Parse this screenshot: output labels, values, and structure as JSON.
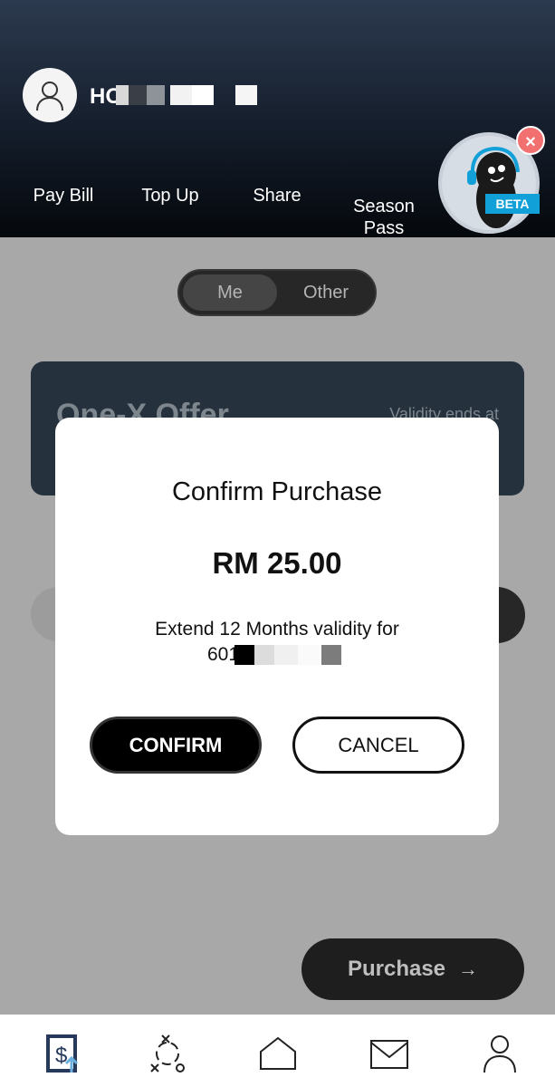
{
  "user": {
    "name_visible": "HO"
  },
  "nav": {
    "items": [
      {
        "label": "Pay Bill"
      },
      {
        "label": "Top Up"
      },
      {
        "label": "Share"
      },
      {
        "label": "Season\nPass"
      }
    ]
  },
  "assistant": {
    "badge": "BETA",
    "close_symbol": "×"
  },
  "toggle": {
    "options": [
      "Me",
      "Other"
    ],
    "selected": "Me"
  },
  "offer": {
    "title": "One-X Offer",
    "validity_label": "Validity ends at"
  },
  "purchase_button": {
    "label": "Purchase",
    "arrow": "→"
  },
  "modal": {
    "title": "Confirm Purchase",
    "amount": "RM 25.00",
    "description": "Extend 12 Months validity for",
    "number_prefix": "601",
    "confirm_label": "CONFIRM",
    "cancel_label": "CANCEL"
  },
  "tabbar": {
    "icons": [
      "billing-icon",
      "tactics-icon",
      "home-icon",
      "mail-icon",
      "profile-icon"
    ]
  },
  "colors": {
    "header_top": "#2c3a4f",
    "header_bottom": "#05080c",
    "beta_badge": "#12a0d8",
    "close_badge": "#f27070",
    "overlay": "#b8b8b8"
  }
}
